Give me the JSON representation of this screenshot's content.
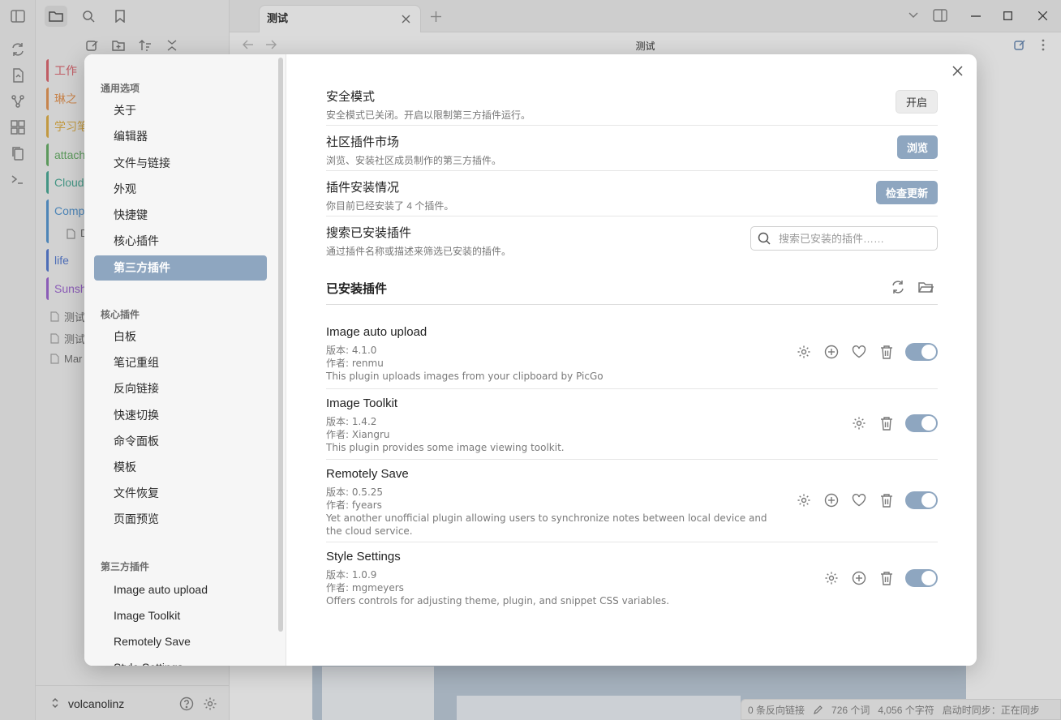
{
  "app": {
    "tab_title": "测试",
    "view_title": "测试",
    "vault_name": "volcanolinz",
    "folders": [
      {
        "label": "工作",
        "color": "#e06c75"
      },
      {
        "label": "琳之",
        "color": "#e89a5a"
      },
      {
        "label": "学习笔",
        "color": "#e2b34c"
      },
      {
        "label": "attach",
        "color": "#6cb36c"
      },
      {
        "label": "Cloud",
        "color": "#4fae9a"
      },
      {
        "label": "Compu",
        "color": "#5a9bd5"
      },
      {
        "label": "life",
        "color": "#5a7fd5"
      },
      {
        "label": "Sunshi",
        "color": "#a26cd5"
      }
    ],
    "files": [
      "测试",
      "测试",
      "Mar"
    ],
    "sub_file": "D",
    "status": {
      "backlinks": "0 条反向链接",
      "words": "726 个词",
      "chars": "4,056 个字符",
      "sync": "启动时同步：正在同步"
    }
  },
  "settings": {
    "nav_groups": [
      {
        "heading": "通用选项",
        "items": [
          "关于",
          "编辑器",
          "文件与链接",
          "外观",
          "快捷键",
          "核心插件",
          "第三方插件"
        ]
      },
      {
        "heading": "核心插件",
        "items": [
          "白板",
          "笔记重组",
          "反向链接",
          "快速切换",
          "命令面板",
          "模板",
          "文件恢复",
          "页面预览"
        ]
      },
      {
        "heading": "第三方插件",
        "items": [
          "Image auto upload",
          "Image Toolkit",
          "Remotely Save",
          "Style Settings"
        ]
      }
    ],
    "active_item": "第三方插件",
    "safe_mode": {
      "name": "安全模式",
      "desc": "安全模式已关闭。开启以限制第三方插件运行。",
      "button": "开启"
    },
    "community": {
      "name": "社区插件市场",
      "desc": "浏览、安装社区成员制作的第三方插件。",
      "button": "浏览"
    },
    "install_status": {
      "name": "插件安装情况",
      "desc": "你目前已经安装了 4 个插件。",
      "button": "检查更新"
    },
    "search": {
      "name": "搜索已安装插件",
      "desc": "通过插件名称或描述来筛选已安装的插件。",
      "placeholder": "搜索已安装的插件……"
    },
    "installed_title": "已安装插件",
    "plugins": [
      {
        "name": "Image auto upload",
        "version": "版本: 4.1.0",
        "author": "作者: renmu",
        "desc": "This plugin uploads images from your clipboard by PicGo",
        "enabled": true
      },
      {
        "name": "Image Toolkit",
        "version": "版本: 1.4.2",
        "author": "作者: Xiangru",
        "desc": "This plugin provides some image viewing toolkit.",
        "enabled": true
      },
      {
        "name": "Remotely Save",
        "version": "版本: 0.5.25",
        "author": "作者: fyears",
        "desc": "Yet another unofficial plugin allowing users to synchronize notes between local device and the cloud service.",
        "enabled": true
      },
      {
        "name": "Style Settings",
        "version": "版本: 1.0.9",
        "author": "作者: mgmeyers",
        "desc": "Offers controls for adjusting theme, plugin, and snippet CSS variables.",
        "enabled": true
      }
    ]
  },
  "colors": {
    "accent": "#8ea6c0"
  }
}
